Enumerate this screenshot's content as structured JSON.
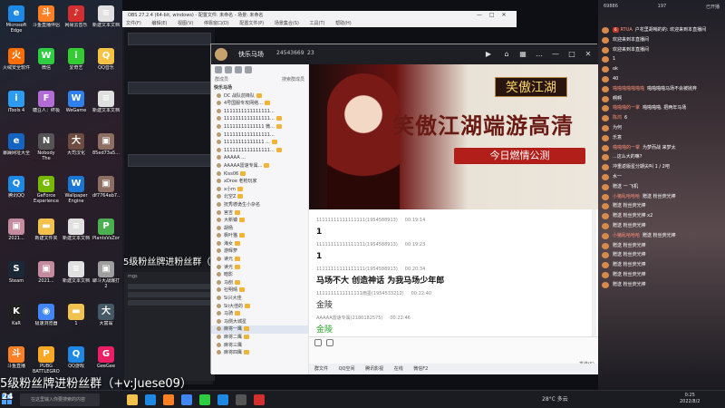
{
  "desktop": {
    "icons": [
      {
        "label": "Microsoft Edge",
        "color": "#1e88e5",
        "glyph": "e"
      },
      {
        "label": "斗鱼直播伴侣",
        "color": "#ff7f24",
        "glyph": "斗"
      },
      {
        "label": "网易云音乐",
        "color": "#d32f2f",
        "glyph": "♪"
      },
      {
        "label": "新建文本文档",
        "color": "#e0e0e0",
        "glyph": "≡"
      },
      {
        "label": "火绒安全软件",
        "color": "#ff6d00",
        "glyph": "火"
      },
      {
        "label": "微信",
        "color": "#2ecc40",
        "glyph": "W"
      },
      {
        "label": "爱奇艺",
        "color": "#33cc33",
        "glyph": "i"
      },
      {
        "label": "QQ音乐",
        "color": "#f6c445",
        "glyph": "Q"
      },
      {
        "label": "iTools 4",
        "color": "#2c9bf0",
        "glyph": "i"
      },
      {
        "label": "糖豆人：终极",
        "color": "#b36bd6",
        "glyph": "F"
      },
      {
        "label": "WeGame",
        "color": "#2f80ed",
        "glyph": "W"
      },
      {
        "label": "新建文本文档",
        "color": "#e0e0e0",
        "glyph": "≡"
      },
      {
        "label": "暴躁网址大全",
        "color": "#1565c0",
        "glyph": "e"
      },
      {
        "label": "Nobody The Turnaround",
        "color": "#555555",
        "glyph": "N"
      },
      {
        "label": "大司汉化",
        "color": "#6d4c41",
        "glyph": "大"
      },
      {
        "label": "85ed73a5...",
        "color": "#8d6e63",
        "glyph": "▣"
      },
      {
        "label": "腾讯QQ",
        "color": "#1e88e5",
        "glyph": "Q"
      },
      {
        "label": "GeForce Experience",
        "color": "#76b900",
        "glyph": "G"
      },
      {
        "label": "Wallpaper Engine",
        "color": "#1976d2",
        "glyph": "W"
      },
      {
        "label": "df7764ab7...",
        "color": "#8d6e63",
        "glyph": "▣"
      },
      {
        "label": "2021...",
        "color": "#c48b9f",
        "glyph": "▣"
      },
      {
        "label": "新建文件夹",
        "color": "#f2c14e",
        "glyph": "▬"
      },
      {
        "label": "新建文本文档",
        "color": "#e0e0e0",
        "glyph": "≡"
      },
      {
        "label": "PlantsVsZombies",
        "color": "#4caf50",
        "glyph": "P"
      },
      {
        "label": "Steam",
        "color": "#1b2838",
        "glyph": "S"
      },
      {
        "label": "2021...",
        "color": "#c48b9f",
        "glyph": "▣"
      },
      {
        "label": "新建文本文档",
        "color": "#e0e0e0",
        "glyph": "≡"
      },
      {
        "label": "聊斗大战爆打2",
        "color": "#9e9e9e",
        "glyph": "▣"
      },
      {
        "label": "KaR",
        "color": "#212121",
        "glyph": "K"
      },
      {
        "label": "极速浏览器",
        "color": "#4285f4",
        "glyph": "◉"
      },
      {
        "label": "1",
        "color": "#f2c14e",
        "glyph": "▬"
      },
      {
        "label": "大富翁",
        "color": "#455a64",
        "glyph": "大"
      },
      {
        "label": "斗鱼直播",
        "color": "#ff7f24",
        "glyph": "斗"
      },
      {
        "label": "PUBG BATTLEGROUNDS",
        "color": "#f9a825",
        "glyph": "P"
      },
      {
        "label": "QQ游戏",
        "color": "#1e88e5",
        "glyph": "Q"
      },
      {
        "label": "GeeGee",
        "color": "#e91e63",
        "glyph": "G"
      }
    ]
  },
  "obs": {
    "title": "OBS 27.2.4 (64-bit, windows) - 配置文件: 未命名 - 场景: 未命名",
    "menu": [
      "文件(F)",
      "编辑(E)",
      "视图(V)",
      "停靠窗口(D)",
      "配置文件(P)",
      "场景集合(S)",
      "工具(T)",
      "帮助(H)"
    ],
    "controls": [
      "—",
      "□",
      "✕"
    ],
    "promo_small": "5级粉丝牌进粉丝群（+v:",
    "source_label": "mgs"
  },
  "qq": {
    "group_name": "快乐马场",
    "group_id": "24543669",
    "member_count": "23",
    "sidebar_title": "群成员",
    "sidebar_search": "搜索群成员",
    "members": [
      {
        "name": "快乐马场",
        "header": true
      },
      {
        "name": "DC 战队前锋队",
        "header": false
      },
      {
        "name": "4号国服专攻网络...",
        "header": false
      },
      {
        "name": "1111111111111111...",
        "header": false
      },
      {
        "name": "1111111111111111...",
        "header": false
      },
      {
        "name": "11111111111111 微...",
        "header": false
      },
      {
        "name": "1111111111111111...",
        "header": false
      },
      {
        "name": "11111111111111 ...",
        "header": false
      },
      {
        "name": "1111111111111111...",
        "header": false
      },
      {
        "name": "AAAAA ...",
        "header": false
      },
      {
        "name": "AAAAA雷速专属...",
        "header": false
      },
      {
        "name": "Kiss06",
        "header": false
      },
      {
        "name": "xDroe 老枪玩家",
        "header": false
      },
      {
        "name": "x小m",
        "header": false
      },
      {
        "name": "北空Z",
        "header": false
      },
      {
        "name": "抚秀德诡生小杂名",
        "header": false
      },
      {
        "name": "宫吉",
        "header": false
      },
      {
        "name": "大新镇",
        "header": false
      },
      {
        "name": "胡杨",
        "header": false
      },
      {
        "name": "枫叶猫",
        "header": false
      },
      {
        "name": "海女",
        "header": false
      },
      {
        "name": "游辉萝",
        "header": false
      },
      {
        "name": "读元",
        "header": false
      },
      {
        "name": "读光",
        "header": false
      },
      {
        "name": "暗影",
        "header": false
      },
      {
        "name": "马刨",
        "header": false
      },
      {
        "name": "社明晴",
        "header": false
      },
      {
        "name": "Si兴大佳",
        "header": false
      },
      {
        "name": "Sii大佳的",
        "header": false
      },
      {
        "name": "马骑",
        "header": false
      },
      {
        "name": "马侧大城星",
        "header": false
      },
      {
        "name": "麻将一鹰",
        "header": false,
        "selected": true
      },
      {
        "name": "麻将二鹰",
        "header": false
      },
      {
        "name": "麻将三鹰",
        "header": false
      },
      {
        "name": "麻将四鹰",
        "header": false
      }
    ],
    "banner": {
      "logo": "笑傲江湖",
      "title": "笑傲江湖端游高清",
      "subtitle": "今日燃情公测"
    },
    "messages": [
      {
        "sender": "11111111111111111(1954588913)",
        "time": "00:19:14",
        "text": "1",
        "style": ""
      },
      {
        "sender": "11111111111111111(1954588913)",
        "time": "00:19:23",
        "text": "1",
        "style": ""
      },
      {
        "sender": "11111111111111111(1954588913)",
        "time": "00:20:34",
        "text": "马场不大  创造神话  为我马场少年郎",
        "style": "serif"
      },
      {
        "sender": "1111111111111111雨墨(1954533212)",
        "time": "00:22:40",
        "text": "金陵",
        "style": "plain"
      },
      {
        "sender": "AAAAA雷速专属(2180182575)",
        "time": "00:22:46",
        "text": "金陵",
        "style": "green"
      }
    ],
    "input_bottom": [
      "群文件",
      "QQ空间",
      "腾讯影视",
      "在线",
      "微信F2"
    ],
    "send_label": "发送(S)"
  },
  "right_panel": {
    "viewers": "69886",
    "likes": "197",
    "status": "已开播",
    "chat": [
      {
        "badge": "6",
        "user": "RTUA",
        "text": "户花里胡哨的的: 欢迎来到本直播间"
      },
      {
        "badge": "",
        "user": "",
        "text": "欢迎来到本直播间"
      },
      {
        "badge": "",
        "user": "",
        "text": "欢迎来到本直播间"
      },
      {
        "badge": "",
        "user": "",
        "text": "1"
      },
      {
        "badge": "",
        "user": "",
        "text": "ok"
      },
      {
        "badge": "",
        "user": "",
        "text": "40"
      },
      {
        "badge": "",
        "user": "啪啪啪啪啪啪啪",
        "text": "啪啪啪啪马场不会被抛弃"
      },
      {
        "badge": "",
        "user": "",
        "text": "啊啊"
      },
      {
        "badge": "",
        "user": "啪啪啪的一掌",
        "text": "啪啪啪啪, 把两年马场"
      },
      {
        "badge": "",
        "user": "陈鸿",
        "text": "6"
      },
      {
        "badge": "",
        "user": "",
        "text": "为何"
      },
      {
        "badge": "",
        "user": "",
        "text": "乐意"
      },
      {
        "badge": "",
        "user": "啪啪啪的一掌",
        "text": "为梦而战 来梦太"
      },
      {
        "badge": "",
        "user": "",
        "text": "...这么大的嘛?"
      },
      {
        "badge": "",
        "user": "",
        "text": "冲重返版星分期尖叫 1 / 2吧"
      },
      {
        "badge": "",
        "user": "",
        "text": "水一"
      },
      {
        "badge": "",
        "user": "",
        "text": "赠送 一 飞机"
      },
      {
        "badge": "",
        "user": "小猪乱哈哈哈",
        "text": "赠送 粉丝荧光棒"
      },
      {
        "badge": "",
        "user": "",
        "text": "赠送 粉丝荧光棒"
      },
      {
        "badge": "",
        "user": "",
        "text": "赠送 粉丝荧光棒 x2"
      },
      {
        "badge": "",
        "user": "",
        "text": "赠送 粉丝荧光棒"
      },
      {
        "badge": "",
        "user": "小猪乱哈哈哈",
        "text": "赠送 粉丝荧光棒"
      },
      {
        "badge": "",
        "user": "",
        "text": "赠送 粉丝荧光棒"
      },
      {
        "badge": "",
        "user": "",
        "text": "赠送 粉丝荧光棒"
      },
      {
        "badge": "",
        "user": "",
        "text": "赠送 粉丝荧光棒"
      },
      {
        "badge": "",
        "user": "",
        "text": "赠送 粉丝荧光棒"
      },
      {
        "badge": "",
        "user": "",
        "text": "赠送 粉丝荧光棒"
      }
    ]
  },
  "big_promo": "5级粉丝牌进粉丝群（+v:Juese09）",
  "taskbar": {
    "search_placeholder": "在这里输入你要搜索的内容",
    "weather": "28°C 多云",
    "time": "0:25",
    "date": "2022/8/2",
    "counter": "24"
  }
}
